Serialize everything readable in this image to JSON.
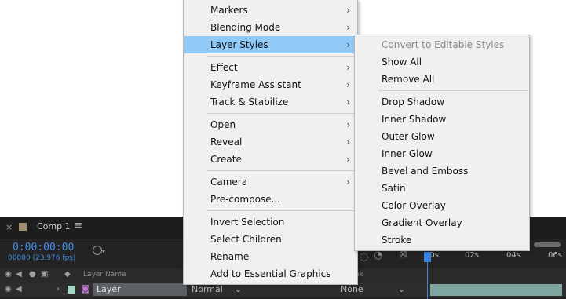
{
  "context_menu": {
    "groups": [
      [
        {
          "label": "Markers",
          "submenu": true
        },
        {
          "label": "Blending Mode",
          "submenu": true
        },
        {
          "label": "Layer Styles",
          "submenu": true,
          "highlighted": true
        }
      ],
      [
        {
          "label": "Effect",
          "submenu": true
        },
        {
          "label": "Keyframe Assistant",
          "submenu": true
        },
        {
          "label": "Track & Stabilize",
          "submenu": true
        }
      ],
      [
        {
          "label": "Open",
          "submenu": true
        },
        {
          "label": "Reveal",
          "submenu": true
        },
        {
          "label": "Create",
          "submenu": true
        }
      ],
      [
        {
          "label": "Camera",
          "submenu": true
        },
        {
          "label": "Pre-compose...",
          "submenu": false
        }
      ],
      [
        {
          "label": "Invert Selection",
          "submenu": false
        },
        {
          "label": "Select Children",
          "submenu": false
        },
        {
          "label": "Rename",
          "submenu": false
        },
        {
          "label": "Add to Essential Graphics",
          "submenu": false
        }
      ]
    ]
  },
  "submenu": {
    "groups": [
      [
        {
          "label": "Convert to Editable Styles",
          "disabled": true
        },
        {
          "label": "Show All",
          "disabled": false
        },
        {
          "label": "Remove All",
          "disabled": false
        }
      ],
      [
        {
          "label": "Drop Shadow",
          "disabled": false
        },
        {
          "label": "Inner Shadow",
          "disabled": false
        },
        {
          "label": "Outer Glow",
          "disabled": false
        },
        {
          "label": "Inner Glow",
          "disabled": false
        },
        {
          "label": "Bevel and Emboss",
          "disabled": false
        },
        {
          "label": "Satin",
          "disabled": false
        },
        {
          "label": "Color Overlay",
          "disabled": false
        },
        {
          "label": "Gradient Overlay",
          "disabled": false
        },
        {
          "label": "Stroke",
          "disabled": false
        }
      ]
    ]
  },
  "timeline": {
    "tab_close": "×",
    "tab_name": "Comp 1",
    "tab_menu": "≡",
    "current_time": "0:00:00:00",
    "frame_info": "00000 (23.976 fps)",
    "ruler_labels": [
      "00s",
      "02s",
      "04s",
      "06s"
    ],
    "header_layer_name": "Layer Name",
    "header_parent": "nk",
    "layer_name": "Layer",
    "layer_mode": "Normal",
    "layer_track_matte": "None"
  },
  "colors": {
    "accent": "#3f8ee8",
    "menu_highlight": "#91c9f7",
    "layer_bar": "#7fa6a1",
    "comp_swatch": "#a08f6e"
  }
}
